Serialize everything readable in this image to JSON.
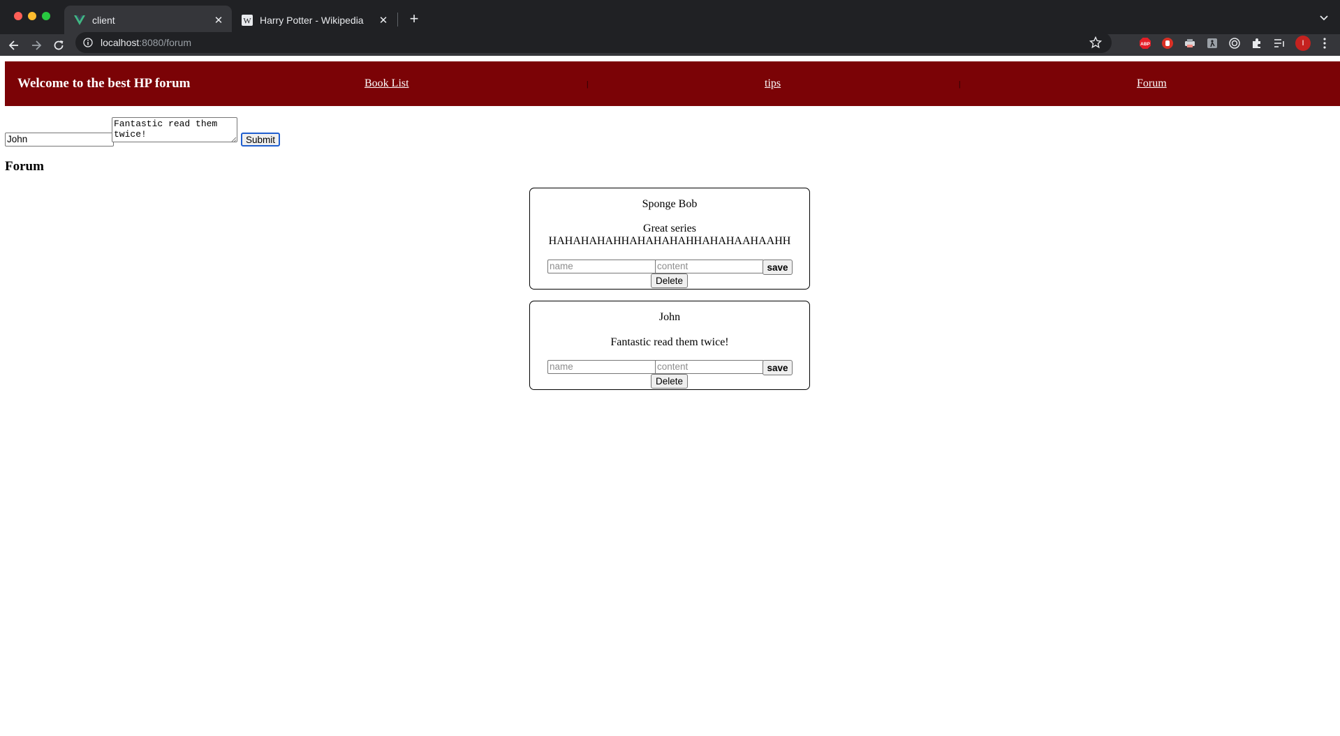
{
  "browser": {
    "tabs": [
      {
        "title": "client",
        "favicon": "vue-logo-icon",
        "active": true
      },
      {
        "title": "Harry Potter - Wikipedia",
        "favicon": "wikipedia-icon",
        "active": false
      }
    ],
    "url_host": "localhost",
    "url_path": ":8080/forum",
    "profile_initial": "I"
  },
  "header": {
    "title": "Welcome to the best HP forum",
    "nav": [
      {
        "label": "Book List"
      },
      {
        "label": "tips"
      },
      {
        "label": "Forum"
      }
    ],
    "separator": "|",
    "colors": {
      "background": "#7b0306",
      "text": "#ffffff"
    }
  },
  "new_post": {
    "name_value": "John",
    "content_value": "Fantastic read them twice!",
    "submit_label": "Submit"
  },
  "forum_heading": "Forum",
  "posts": [
    {
      "author": "Sponge Bob",
      "content": "Great series HAHAHAHAHHAHAHAHAHHAHAHAAHAAHH"
    },
    {
      "author": "John",
      "content": "Fantastic read them twice!"
    }
  ],
  "post_edit": {
    "name_placeholder": "name",
    "content_placeholder": "content",
    "save_label": "save",
    "delete_label": "Delete"
  }
}
